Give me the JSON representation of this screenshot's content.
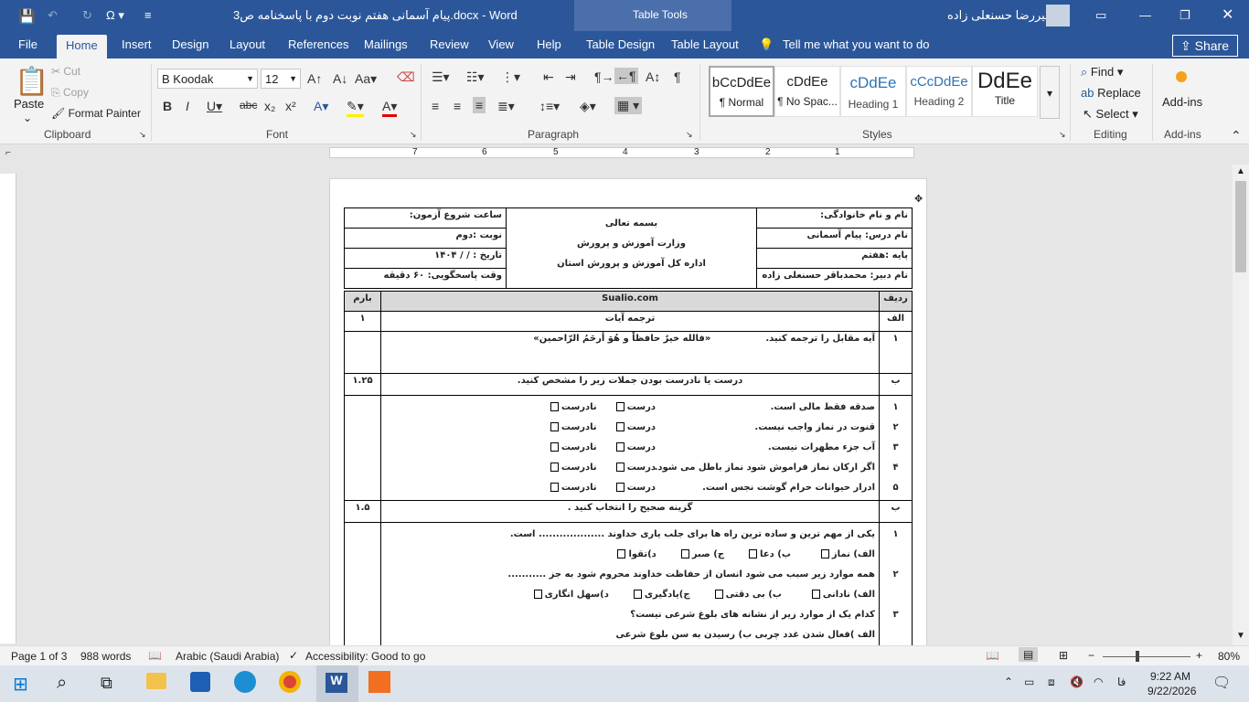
{
  "titlebar": {
    "title": "پیام آسمانی هفتم نوبت دوم با پاسخنامه ص3.docx  -  Word",
    "context": "Table Tools",
    "user": "امیررضا حسنعلی زاده"
  },
  "tabs": [
    "File",
    "Home",
    "Insert",
    "Design",
    "Layout",
    "References",
    "Mailings",
    "Review",
    "View",
    "Help",
    "Table Design",
    "Table Layout"
  ],
  "tell_me": "Tell me what you want to do",
  "share": "Share",
  "clipboard": {
    "paste": "Paste",
    "cut": "Cut",
    "copy": "Copy",
    "format_painter": "Format Painter",
    "group": "Clipboard"
  },
  "font": {
    "name": "B Koodak",
    "size": "12",
    "group": "Font"
  },
  "paragraph": {
    "group": "Paragraph"
  },
  "styles": {
    "group": "Styles",
    "items": [
      {
        "preview": "bCcDdEe",
        "name": "¶ Normal"
      },
      {
        "preview": "cDdEe",
        "name": "¶ No Spac..."
      },
      {
        "preview": "cDdEe",
        "name": "Heading 1"
      },
      {
        "preview": "cCcDdEe",
        "name": "Heading 2"
      },
      {
        "preview": "DdEe",
        "name": "Title"
      }
    ]
  },
  "editing": {
    "find": "Find",
    "replace": "Replace",
    "select": "Select",
    "group": "Editing"
  },
  "addins": {
    "label": "Add-ins",
    "group": "Add-ins"
  },
  "ruler": {
    "numbers": [
      "7",
      "6",
      "5",
      "4",
      "3",
      "2",
      "1"
    ]
  },
  "header": {
    "r1": [
      "نام و نام خانوادگی:",
      "بسمه تعالی",
      "ساعت شروع آزمون:"
    ],
    "r2": [
      "نام درس: پیام آسمانی",
      "وزارت آموزش و پرورش",
      "نوبت :دوم"
    ],
    "r3": [
      "پایه :هفتم",
      "اداره کل آموزش و پرورش استان",
      "تاریخ :    /    /  ۱۴۰۴"
    ],
    "r4": [
      "نام دبیر: محمدباقر حسنعلی زاده",
      "",
      "وقت پاسخگویی: ۶۰ دقیقه"
    ]
  },
  "exam": {
    "col_row": "ردیف",
    "col_site": "Sualio.com",
    "col_score": "بارم",
    "secA": {
      "label": "الف",
      "title": "ترجمه آیات",
      "score": "۱",
      "q_no": "۱",
      "q_text": "آیه مقابل را ترجمه کنید.",
      "q_verse": "«فالله خیرٌ حافظاً و هُوَ أرحَمُ الرّاحمین»"
    },
    "secB": {
      "label": "ب",
      "title": "درست یا نادرست بودن جملات زیر را مشخص کنید.",
      "score": "۱.۲۵",
      "true": "درست",
      "false": "نادرست",
      "items": [
        {
          "no": "۱",
          "text": "صدقه فقط مالی است."
        },
        {
          "no": "۲",
          "text": "قنوت در نماز واجب نیست."
        },
        {
          "no": "۳",
          "text": "آب جزء مطهرات نیست."
        },
        {
          "no": "۴",
          "text": "اگر ارکان نماز فراموش شود نماز باطل می شود."
        },
        {
          "no": "۵",
          "text": "ادرار حیوانات حرام گوشت نجس است."
        }
      ]
    },
    "secC": {
      "label": "ب",
      "title": "گزینه صحیح را انتخاب کنید .",
      "score": "۱.۵",
      "q1": "یکی از مهم ترین و ساده ترین راه ها برای جلب یاری خداوند ................... است.",
      "q1_opts": [
        "الف) نماز",
        "ب) دعا",
        "ج) صبر",
        "د)تقوا"
      ],
      "q2": "همه موارد زیر سبب می شود انسان از حفاظت خداوند محروم شود به جز ...........",
      "q2_opts": [
        "الف) نادانی",
        "ب) بی دقتی",
        "ج)یادگیری",
        "د)سهل انگاری"
      ],
      "q3": "کدام یک از موارد زیر از نشانه های بلوغ شرعی نیست؟",
      "q3_opts": "الف )فعال شدن غدد چربی       ب) رسیدن به سن بلوغ شرعی"
    }
  },
  "status": {
    "page": "Page 1 of 3",
    "words": "988 words",
    "lang": "Arabic (Saudi Arabia)",
    "access": "Accessibility: Good to go",
    "zoom": "80%"
  },
  "taskbar": {
    "time": "9:22 AM",
    "date": "9/22/2026",
    "ime": "فا"
  }
}
